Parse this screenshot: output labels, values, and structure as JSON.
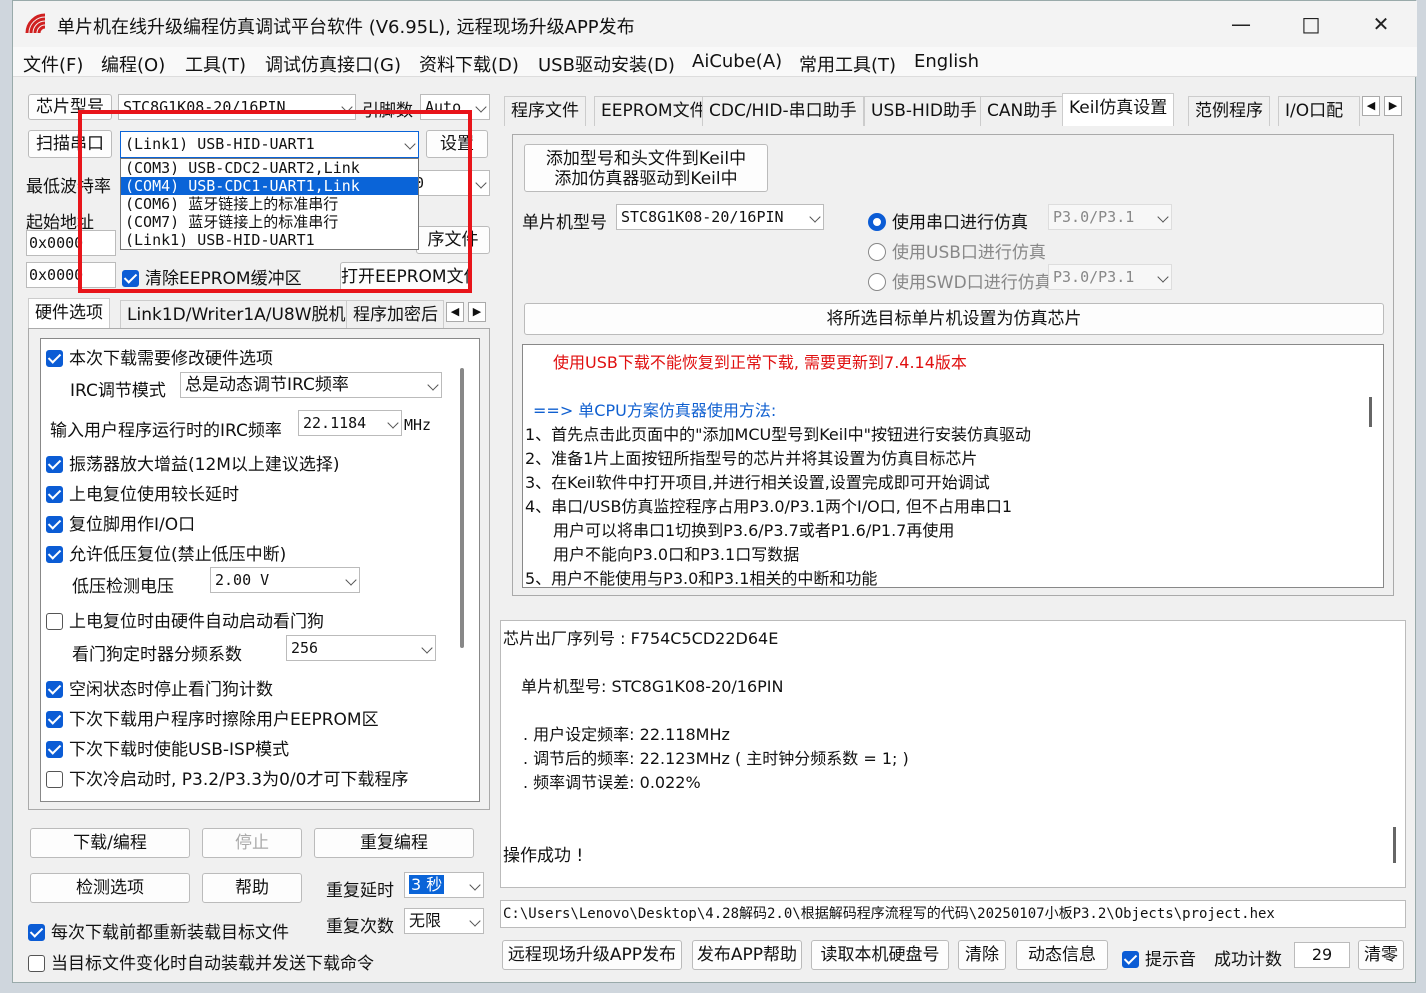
{
  "window": {
    "title": "单片机在线升级编程仿真调试平台软件 (V6.95L), 远程现场升级APP发布"
  },
  "menu": [
    "文件(F)",
    "编程(O)",
    "工具(T)",
    "调试仿真接口(G)",
    "资料下载(D)",
    "USB驱动安装(D)",
    "AiCube(A)",
    "常用工具(T)",
    "English"
  ],
  "left": {
    "chip_label": "芯片型号",
    "chip_value": "STC8G1K08-20/16PIN",
    "pins_label": "引脚数",
    "pins_value": "Auto",
    "scan_label": "扫描串口",
    "port_value": "(Link1) USB-HID-UART1",
    "settings_label": "设置",
    "port_options": [
      "(COM3) USB-CDC2-UART2,Link",
      "(COM4) USB-CDC1-UART1,Link",
      "(COM6) 蓝牙链接上的标准串行",
      "(COM7) 蓝牙链接上的标准串行",
      "(Link1) USB-HID-UART1"
    ],
    "baud_label": "最低波特率",
    "baud_value": "0",
    "start_addr_label": "起始地址",
    "addr1": "0x0000",
    "addr2": "0x0000",
    "open_prog_label": "序文件",
    "clear_eeprom_label": "清除EEPROM缓冲区",
    "open_eeprom_label": "打开EEPROM文件",
    "tabs": [
      "硬件选项",
      "Link1D/Writer1A/U8W脱机",
      "程序加密后"
    ],
    "options": {
      "modify_hw": "本次下载需要修改硬件选项",
      "irc_mode_label": "IRC调节模式",
      "irc_mode_value": "总是动态调节IRC频率",
      "irc_freq_label": "输入用户程序运行时的IRC频率",
      "irc_freq_value": "22.1184",
      "irc_unit": "MHz",
      "osc_gain": "振荡器放大增益(12M以上建议选择)",
      "long_reset": "上电复位使用较长延时",
      "reset_io": "复位脚用作I/O口",
      "lvr": "允许低压复位(禁止低压中断)",
      "lvd_label": "低压检测电压",
      "lvd_value": "2.00 V",
      "wdt_auto": "上电复位时由硬件自动启动看门狗",
      "wdt_div_label": "看门狗定时器分频系数",
      "wdt_div_value": "256",
      "idle_wdt": "空闲状态时停止看门狗计数",
      "erase_eeprom": "下次下载用户程序时擦除用户EEPROM区",
      "usb_isp": "下次下载时使能USB-ISP模式",
      "cold_boot": "下次冷启动时, P3.2/P3.3为0/0才可下载程序"
    },
    "download_label": "下载/编程",
    "stop_label": "停止",
    "reprogram_label": "重复编程",
    "check_label": "检测选项",
    "help_label": "帮助",
    "repeat_delay_label": "重复延时",
    "repeat_delay_value": "3 秒",
    "repeat_count_label": "重复次数",
    "repeat_count_value": "无限",
    "reload_label": "每次下载前都重新装载目标文件",
    "auto_send_label": "当目标文件变化时自动装载并发送下载命令"
  },
  "right": {
    "tabs": [
      "程序文件",
      "EEPROM文件",
      "CDC/HID-串口助手",
      "USB-HID助手",
      "CAN助手",
      "Keil仿真设置",
      "范例程序",
      "I/O口配"
    ],
    "add_keil_line1": "添加型号和头文件到Keil中",
    "add_keil_line2": "添加仿真器驱动到Keil中",
    "mcu_label": "单片机型号",
    "mcu_value": "STC8G1K08-20/16PIN",
    "radio_serial": "使用串口进行仿真",
    "serial_pins": "P3.0/P3.1",
    "radio_usb": "使用USB口进行仿真",
    "radio_swd": "使用SWD口进行仿真",
    "swd_pins": "P3.0/P3.1",
    "set_target_label": "将所选目标单片机设置为仿真芯片",
    "notes": {
      "warn": "使用USB下载不能恢复到正常下载, 需要更新到7.4.14版本",
      "heading": "==> 单CPU方案仿真器使用方法:",
      "lines": [
        "1、首先点击此页面中的\"添加MCU型号到Keil中\"按钮进行安装仿真驱动",
        "2、准备1片上面按钮所指型号的芯片并将其设置为仿真目标芯片",
        "3、在Keil软件中打开项目,并进行相关设置,设置完成即可开始调试",
        "4、串口/USB仿真监控程序占用P3.0/P3.1两个I/O口, 但不占用串口1",
        "用户可以将串口1切换到P3.6/P3.7或者P1.6/P1.7再使用",
        "用户不能向P3.0口和P3.1口写数据",
        "5、用户不能使用与P3.0和P3.1相关的中断和功能"
      ]
    },
    "log": {
      "serial": "芯片出厂序列号 : F754C5CD22D64E",
      "mcu": "单片机型号: STC8G1K08-20/16PIN",
      "set_freq": ". 用户设定频率: 22.118MHz",
      "adj_freq": ". 调节后的频率: 22.123MHz ( 主时钟分频系数 = 1; )",
      "err": ". 频率调节误差: 0.022%",
      "success": "操作成功 !"
    },
    "path": "C:\\Users\\Lenovo\\Desktop\\4.28解码2.0\\根据解码程序流程写的代码\\20250107小板P3.2\\Objects\\project.hex",
    "bottom": {
      "publish": "远程现场升级APP发布",
      "publish_help": "发布APP帮助",
      "read_disk": "读取本机硬盘号",
      "clear": "清除",
      "dyn_info": "动态信息",
      "beep": "提示音",
      "count_label": "成功计数",
      "count_value": "29",
      "zero": "清零"
    }
  }
}
